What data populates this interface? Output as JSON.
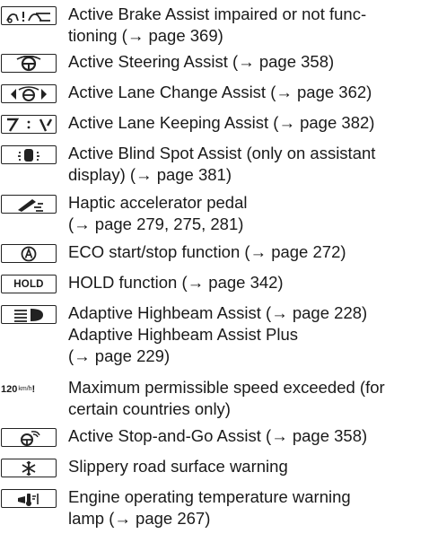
{
  "entries": [
    {
      "icon": "brake-assist-icon",
      "lines": [
        "Active Brake Assist impaired or not func-",
        "tioning (→ page 369)"
      ]
    },
    {
      "icon": "steering-assist-icon",
      "lines": [
        "Active Steering Assist (→ page 358)"
      ]
    },
    {
      "icon": "lane-change-assist-icon",
      "lines": [
        "Active Lane Change Assist (→ page 362)"
      ]
    },
    {
      "icon": "lane-keeping-assist-icon",
      "lines": [
        "Active Lane Keeping Assist (→ page 382)"
      ]
    },
    {
      "icon": "blind-spot-assist-icon",
      "lines": [
        "Active Blind Spot Assist (only on assistant",
        "display) (→ page 381)"
      ]
    },
    {
      "icon": "haptic-pedal-icon",
      "lines": [
        "Haptic accelerator pedal",
        "(→ page 279, 275, 281)"
      ]
    },
    {
      "icon": "eco-start-stop-icon",
      "lines": [
        "ECO start/stop function (→ page 272)"
      ]
    },
    {
      "icon": "hold-icon",
      "icon_text": "HOLD",
      "lines": [
        "HOLD function (→ page 342)"
      ]
    },
    {
      "icon": "highbeam-assist-icon",
      "lines": [
        "Adaptive Highbeam Assist (→ page 228)",
        "Adaptive Highbeam Assist Plus",
        "(→ page 229)"
      ]
    },
    {
      "icon": "speed-limit-icon",
      "icon_text": "120",
      "icon_unit": "km/h",
      "icon_mark": "!",
      "lines": [
        "Maximum permissible speed exceeded (for",
        "certain countries only)"
      ]
    },
    {
      "icon": "stop-and-go-assist-icon",
      "lines": [
        "Active Stop-and-Go Assist (→ page 358)"
      ]
    },
    {
      "icon": "slippery-road-icon",
      "lines": [
        "Slippery road surface warning"
      ]
    },
    {
      "icon": "engine-temperature-icon",
      "lines": [
        "Engine operating temperature warning",
        "lamp (→ page 267)"
      ]
    }
  ]
}
